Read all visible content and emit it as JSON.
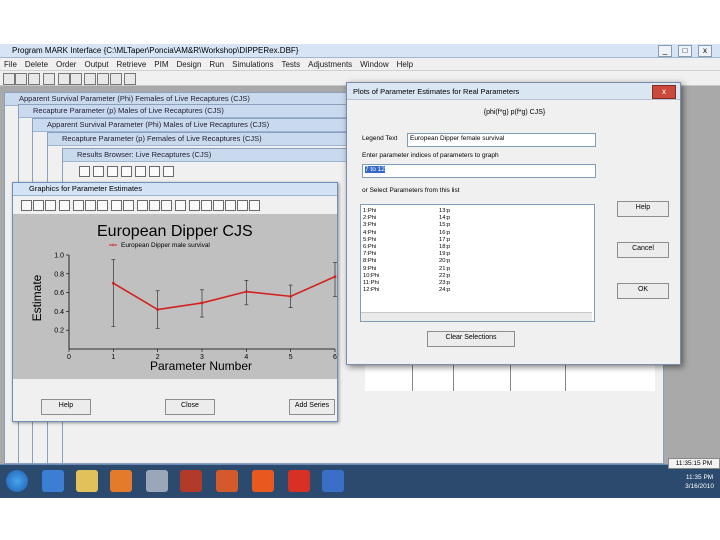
{
  "app": {
    "title": "Program MARK Interface  {C:\\MLTaper\\Poncia\\AM&R\\Workshop\\DIPPERex.DBF}",
    "win_buttons": [
      "_",
      "□",
      "x"
    ]
  },
  "menu": [
    "File",
    "Delete",
    "Order",
    "Output",
    "Retrieve",
    "PIM",
    "Design",
    "Run",
    "Simulations",
    "Tests",
    "Adjustments",
    "Window",
    "Help"
  ],
  "child_windows": [
    "Apparent Survival Parameter (Phi) Females of Live Recaptures (CJS)",
    "Recapture Parameter (p) Males of Live Recaptures (CJS)",
    "Apparent Survival Parameter (Phi) Males of Live Recaptures (CJS)",
    "Recapture Parameter (p) Females of Live Recaptures (CJS)",
    "Results Browser: Live Recaptures (CJS)"
  ],
  "graphics_window": {
    "title": "Graphics for Parameter Estimates",
    "help_label": "Help",
    "close_label": "Close",
    "add_series_label": "Add Series"
  },
  "chart_data": {
    "type": "line",
    "title": "European Dipper  CJS",
    "legend": "European Dipper male survival",
    "xlabel": "Parameter Number",
    "ylabel": "Estimate",
    "xlim": [
      0,
      6
    ],
    "ylim": [
      0,
      1.0
    ],
    "xticks": [
      0,
      1,
      2,
      3,
      4,
      5,
      6
    ],
    "yticks": [
      0.2,
      0.4,
      0.6,
      0.8,
      1.0
    ],
    "x": [
      1,
      2,
      3,
      4,
      5,
      6
    ],
    "values": [
      0.7,
      0.42,
      0.49,
      0.61,
      0.56,
      0.77
    ],
    "error_low": [
      0.24,
      0.22,
      0.34,
      0.47,
      0.44,
      0.56
    ],
    "error_high": [
      0.95,
      0.62,
      0.63,
      0.73,
      0.68,
      0.92
    ],
    "line_color": "#d32020"
  },
  "plots_dialog": {
    "title": "Plots of Parameter Estimates for Real Parameters",
    "close_glyph": "x",
    "model_name": "{phi(f*g) p(f*g) CJS}",
    "legend_label": "Legend Text",
    "legend_value": "European Dipper female survival",
    "indices_label": "Enter parameter indices of parameters to graph",
    "indices_value": "7 to 12",
    "select_label": "or Select Parameters from this list",
    "list_left": [
      "1:Phi",
      "2:Phi",
      "3:Phi",
      "4:Phi",
      "5:Phi",
      "6:Phi",
      "7:Phi",
      "8:Phi",
      "9:Phi",
      "10:Phi",
      "11:Phi",
      "12:Phi"
    ],
    "list_right": [
      "13:p",
      "14:p",
      "15:p",
      "16:p",
      "17:p",
      "18:p",
      "19:p",
      "20:p",
      "21:p",
      "22:p",
      "23:p",
      "24:p"
    ],
    "help_label": "Help",
    "cancel_label": "Cancel",
    "ok_label": "OK",
    "clear_label": "Clear Selections"
  },
  "taskbar": {
    "tooltip_time": "11:35:15 PM",
    "time": "11:35 PM",
    "date": "3/16/2010"
  },
  "colors": {
    "taskbar": "#2b4a6e",
    "plot_bg": "#c0c0c0",
    "series": "#d32020"
  }
}
